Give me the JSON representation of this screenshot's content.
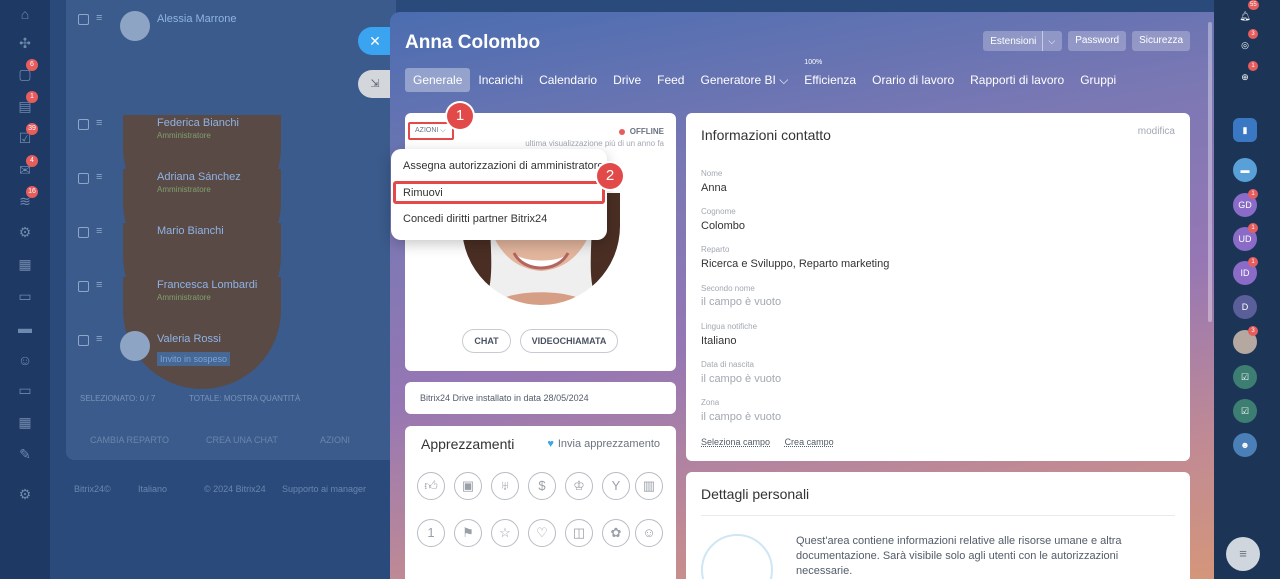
{
  "left_rail": {
    "badges": [
      "6",
      "1",
      "39",
      "4",
      "16"
    ]
  },
  "background_list": {
    "rows": [
      {
        "name": "Alessia Marrone",
        "role": "",
        "tag": ""
      },
      {
        "name": "Federica Bianchi",
        "role": "Amministratore",
        "tag": ""
      },
      {
        "name": "Adriana Sánchez",
        "role": "Amministratore",
        "tag": ""
      },
      {
        "name": "Mario Bianchi",
        "role": "",
        "tag": ""
      },
      {
        "name": "Francesca Lombardi",
        "role": "Amministratore",
        "tag": ""
      },
      {
        "name": "Valeria Rossi",
        "role": "",
        "tag": "Invito in sospeso"
      }
    ],
    "selected": "SELEZIONATO: 0 / 7",
    "total": "TOTALE: MOSTRA QUANTITÀ",
    "buttons": [
      "CAMBIA REPARTO",
      "CREA UNA CHAT",
      "AZIONI"
    ],
    "bottom": [
      "Bitrix24©",
      "Italiano",
      "© 2024 Bitrix24",
      "Supporto ai manager"
    ]
  },
  "profile": {
    "name": "Anna Colombo",
    "top_buttons": {
      "extensions": "Estensioni",
      "password": "Password",
      "security": "Sicurezza"
    },
    "tabs": [
      {
        "label": "Generale",
        "active": true
      },
      {
        "label": "Incarichi"
      },
      {
        "label": "Calendario"
      },
      {
        "label": "Drive"
      },
      {
        "label": "Feed"
      },
      {
        "label": "Generatore BI ⌵"
      },
      {
        "label": "Efficienza",
        "super": "100%"
      },
      {
        "label": "Orario di lavoro"
      },
      {
        "label": "Rapporti di lavoro"
      },
      {
        "label": "Gruppi"
      }
    ],
    "status": "OFFLINE",
    "last_seen": "ultima visualizzazione più di un anno fa",
    "actions_label": "AZIONI",
    "actions_menu": [
      "Assegna autorizzazioni di amministratore",
      "Rimuovi",
      "Concedi diritti partner Bitrix24"
    ],
    "markers": [
      "1",
      "2"
    ],
    "chat": "CHAT",
    "video_call": "VIDEOCHIAMATA",
    "drive_note": "Bitrix24 Drive installato in data 28/05/2024",
    "appreciation_title": "Apprezzamenti",
    "send_appreciation": "Invia apprezzamento"
  },
  "contact_info": {
    "title": "Informazioni contatto",
    "edit": "modifica",
    "fields": [
      {
        "label": "Nome",
        "value": "Anna"
      },
      {
        "label": "Cognome",
        "value": "Colombo"
      },
      {
        "label": "Reparto",
        "value": "Ricerca e Sviluppo, Reparto marketing"
      },
      {
        "label": "Secondo nome",
        "value": "il campo è vuoto"
      },
      {
        "label": "Lingua notifiche",
        "value": "Italiano"
      },
      {
        "label": "Data di nascita",
        "value": "il campo è vuoto"
      },
      {
        "label": "Zona",
        "value": "il campo è vuoto"
      }
    ],
    "select_field": "Seleziona campo",
    "create_field": "Crea campo"
  },
  "personal": {
    "title": "Dettagli personali",
    "description": "Quest'area contiene informazioni relative alle risorse umane e altra documentazione. Sarà visibile solo agli utenti con le autorizzazioni necessarie."
  },
  "right_rail": {
    "badges": {
      "bell": "55",
      "a": "3",
      "b": "1",
      "gd": "1",
      "ud": "1",
      "id": "1",
      "av": "3"
    },
    "initials": [
      "GD",
      "UD",
      "ID",
      "D"
    ]
  }
}
